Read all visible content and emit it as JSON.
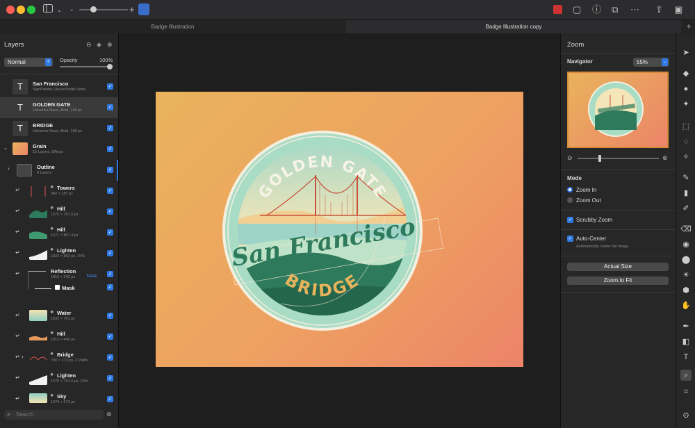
{
  "tabs": [
    "Badge Illustration",
    "Badge Illustration copy"
  ],
  "layers_panel": {
    "title": "Layers",
    "blend_mode": "Normal",
    "opacity_label": "Opacity",
    "opacity_value": "100%",
    "search_placeholder": "Search",
    "layers": [
      {
        "name": "San Francisco",
        "sub": "SignPainter, HouseScript Semi..."
      },
      {
        "name": "GOLDEN GATE",
        "sub": "Helvetica Neue, Bold, 158 px"
      },
      {
        "name": "BRIDGE",
        "sub": "Helvetica Neue, Bold, 158 px"
      },
      {
        "name": "Grain",
        "sub": "15 Layers, Effects"
      },
      {
        "name": "Outline",
        "sub": "4 Layers"
      },
      {
        "name": "Towers",
        "sub": "342 × 187 px"
      },
      {
        "name": "Hill",
        "sub": "1575 × 761.5 px"
      },
      {
        "name": "Hill",
        "sub": "1671 × 807.4 px"
      },
      {
        "name": "Lighten",
        "sub": "1822 × 892 px, 15%"
      },
      {
        "name": "Reflection",
        "sub": "1812 × 242 px",
        "badge": "Mask"
      },
      {
        "name": "Mask",
        "sub": ""
      },
      {
        "name": "Water",
        "sub": "1632 × 761 px"
      },
      {
        "name": "Hill",
        "sub": "1812 × 440 px"
      },
      {
        "name": "Bridge",
        "sub": "790 × 173 px, 2 Paths"
      },
      {
        "name": "Lighten",
        "sub": "1575 × 761.6 px, 20%"
      },
      {
        "name": "Sky",
        "sub": "1674 × 573 px"
      }
    ]
  },
  "badge": {
    "top_text": "GOLDEN GATE",
    "script_text": "San Francisco",
    "bottom_text": "BRIDGE"
  },
  "zoom_panel": {
    "title": "Zoom",
    "navigator_label": "Navigator",
    "zoom_value": "55%",
    "mode_label": "Mode",
    "zoom_in": "Zoom In",
    "zoom_out": "Zoom Out",
    "scrubby_zoom": "Scrubby Zoom",
    "auto_center": "Auto-Center",
    "auto_center_desc": "Automatically center the image.",
    "actual_size": "Actual Size",
    "zoom_to_fit": "Zoom to Fit"
  },
  "colors": {
    "accent": "#2f7ae5",
    "canvas_start": "#e9b35c",
    "canvas_end": "#ec8468",
    "badge_green": "#2e7a5c"
  }
}
